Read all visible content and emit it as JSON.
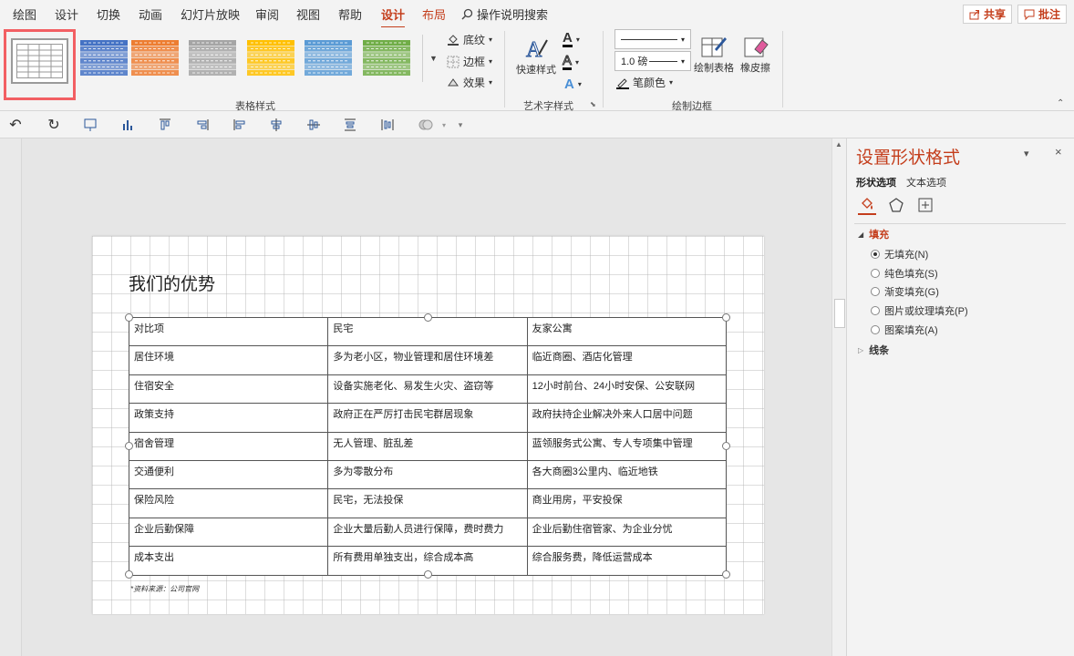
{
  "menu": {
    "tabs": [
      "绘图",
      "设计",
      "切换",
      "动画",
      "幻灯片放映",
      "审阅",
      "视图",
      "帮助",
      "设计",
      "布局"
    ],
    "tell_me": "操作说明搜索",
    "share": "共享",
    "comments": "批注"
  },
  "ribbon": {
    "table_styles": {
      "group_label": "表格样式",
      "shading": "底纹",
      "borders": "边框",
      "effects": "效果",
      "style_colors": [
        "#4472c4",
        "#ed7d31",
        "#a5a5a5",
        "#ffc000",
        "#5b9bd5",
        "#70ad47"
      ]
    },
    "wordart": {
      "group_label": "艺术字样式",
      "quick_styles": "快速样式"
    },
    "draw_borders": {
      "group_label": "绘制边框",
      "pen_weight": "1.0 磅",
      "pen_color": "笔颜色",
      "draw_table": "绘制表格",
      "eraser": "橡皮擦"
    }
  },
  "slide": {
    "title": "我们的优势",
    "table": [
      [
        "对比项",
        "民宅",
        "友家公寓"
      ],
      [
        "居住环境",
        "多为老小区，物业管理和居住环境差",
        "临近商圈、酒店化管理"
      ],
      [
        "住宿安全",
        "设备实施老化、易发生火灾、盗窃等",
        "12小时前台、24小时安保、公安联网"
      ],
      [
        "政策支持",
        "政府正在严厉打击民宅群居现象",
        "政府扶持企业解决外来人口居中问题"
      ],
      [
        "宿舍管理",
        "无人管理、脏乱差",
        "蓝领服务式公寓、专人专项集中管理"
      ],
      [
        "交通便利",
        "多为零散分布",
        "各大商圈3公里内、临近地铁"
      ],
      [
        "保险风险",
        "民宅，无法投保",
        "商业用房，平安投保"
      ],
      [
        "企业后勤保障",
        "企业大量后勤人员进行保障，费时费力",
        "企业后勤住宿管家、为企业分忧"
      ],
      [
        "成本支出",
        "所有费用单独支出，综合成本高",
        "综合服务费，降低运营成本"
      ]
    ],
    "source_note": "*资料来源：公司官网"
  },
  "pane": {
    "title": "设置形状格式",
    "tabs": [
      "形状选项",
      "文本选项"
    ],
    "fill_section": "填充",
    "fill_options": [
      "无填充(N)",
      "纯色填充(S)",
      "渐变填充(G)",
      "图片或纹理填充(P)",
      "图案填充(A)"
    ],
    "line_section": "线条"
  }
}
